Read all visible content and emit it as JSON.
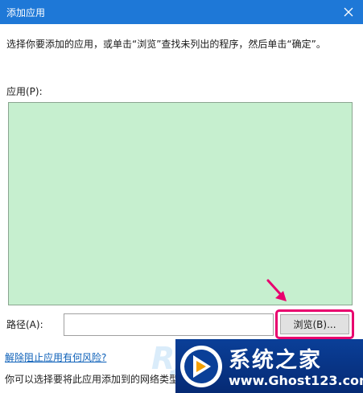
{
  "window": {
    "title": "添加应用",
    "close_icon": "close-icon"
  },
  "instruction": "选择你要添加的应用，或单击“浏览”查找未列出的程序，然后单击“确定”。",
  "apps": {
    "label": "应用(P):",
    "background": "#c6efcf"
  },
  "path": {
    "label": "路径(A):",
    "value": "",
    "browse_label": "浏览(B)..."
  },
  "links": {
    "unblock_risk": "解除阻止应用有何风险?"
  },
  "network_text": "你可以选择要将此应用添加到的网络类型",
  "annotation": {
    "highlight_color": "#e8006e",
    "arrow_icon": "pointer-arrow-icon"
  },
  "watermark": {
    "faded_text": "RJ",
    "logo_icon": "ghost-logo-icon",
    "title": "系统之家",
    "url": "www.Ghost123.com"
  }
}
